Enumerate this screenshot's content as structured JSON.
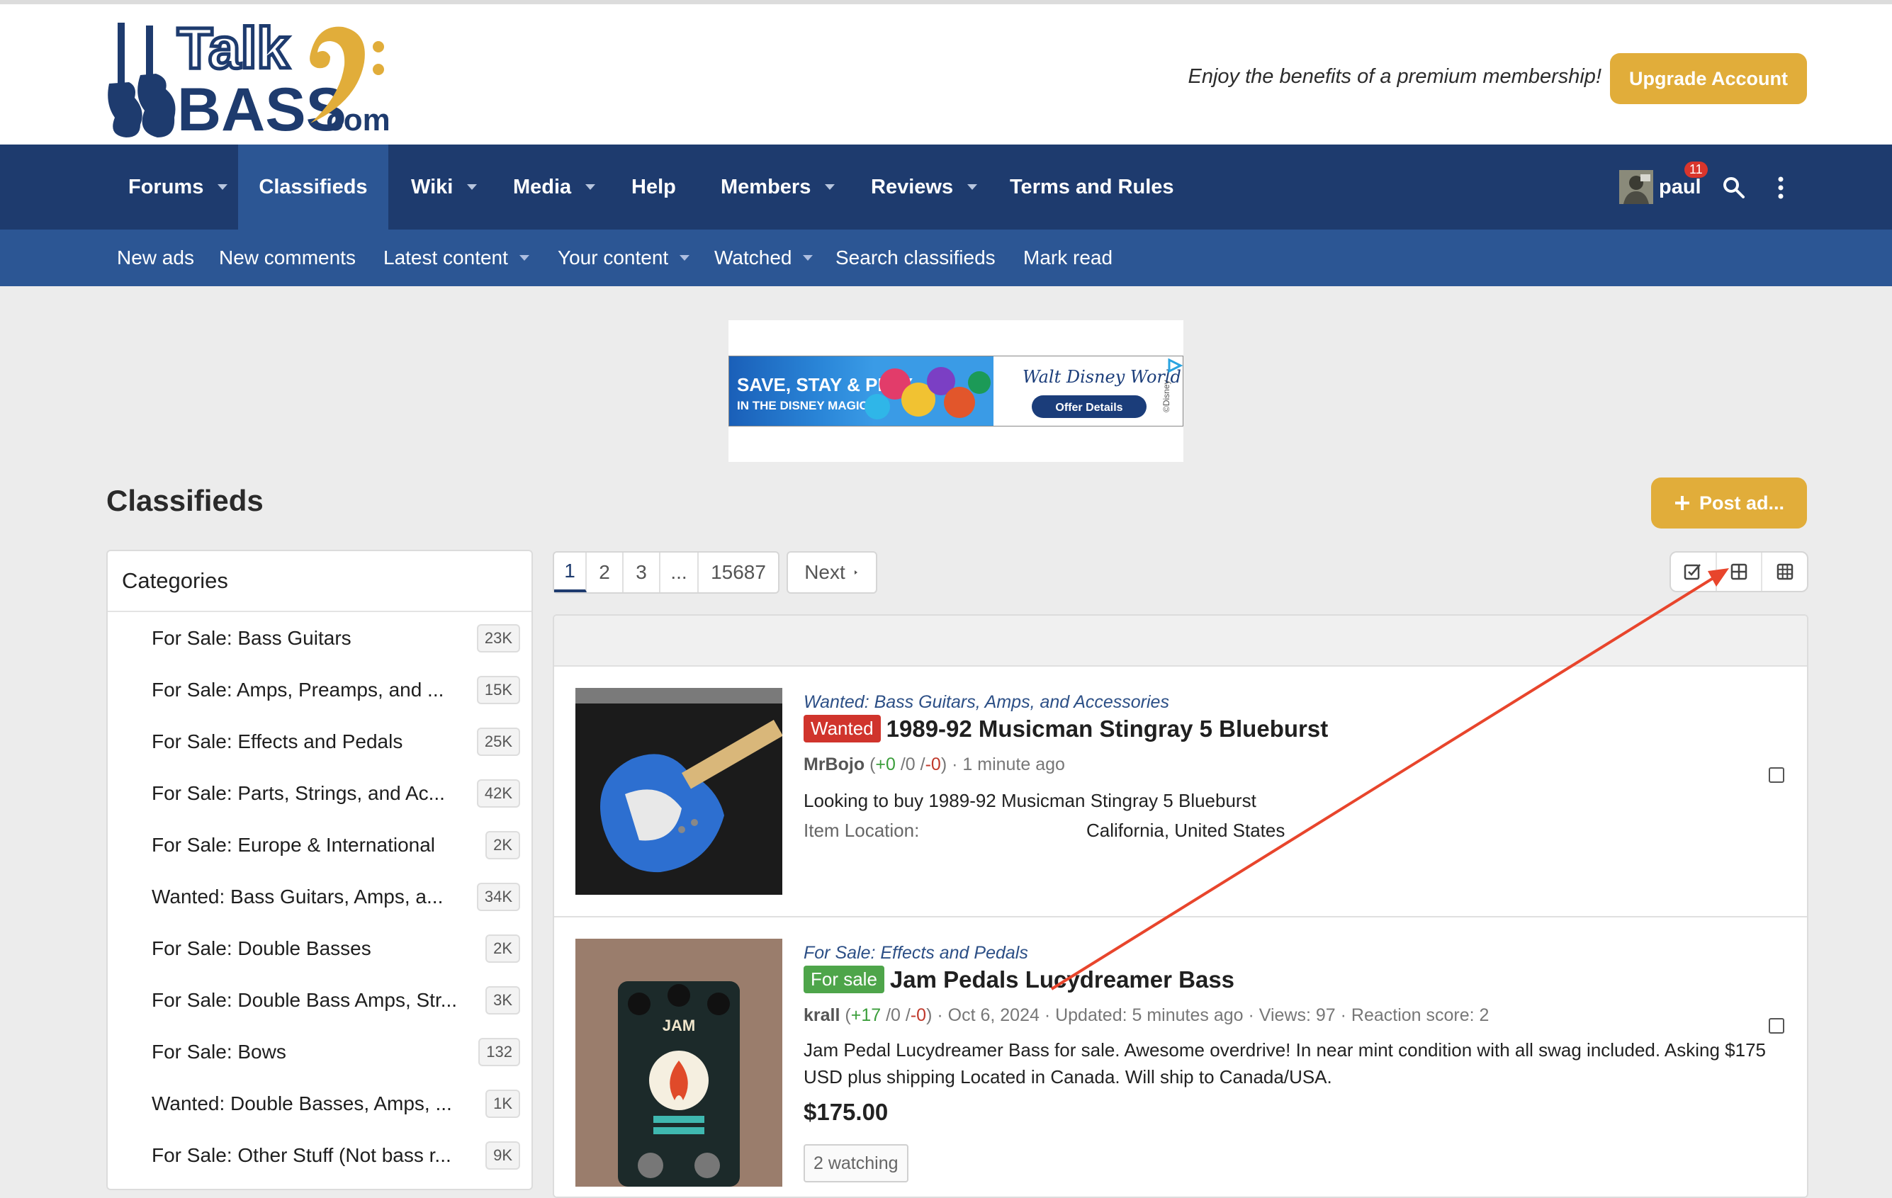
{
  "header": {
    "logo_top": "Talk",
    "logo_bottom": "BASS",
    "logo_suffix": ".com",
    "promo_text": "Enjoy the benefits of a premium membership!",
    "upgrade_label": "Upgrade Account"
  },
  "nav": {
    "items": [
      {
        "label": "Forums"
      },
      {
        "label": "Classifieds"
      },
      {
        "label": "Wiki"
      },
      {
        "label": "Media"
      },
      {
        "label": "Help"
      },
      {
        "label": "Members"
      },
      {
        "label": "Reviews"
      },
      {
        "label": "Terms and Rules"
      }
    ],
    "user_name": "paul",
    "notification_count": "11"
  },
  "subnav": {
    "items": [
      {
        "label": "New ads"
      },
      {
        "label": "New comments"
      },
      {
        "label": "Latest content"
      },
      {
        "label": "Your content"
      },
      {
        "label": "Watched"
      },
      {
        "label": "Search classifieds"
      },
      {
        "label": "Mark read"
      }
    ]
  },
  "ad": {
    "line1": "SAVE, STAY & PLAY",
    "line2": "IN THE DISNEY MAGIC!",
    "brand": "Walt Disney World",
    "cta": "Offer Details",
    "tag": "©Disney"
  },
  "page": {
    "title": "Classifieds",
    "post_ad_label": "Post ad..."
  },
  "categories": {
    "heading": "Categories",
    "items": [
      {
        "label": "For Sale: Bass Guitars",
        "count": "23K"
      },
      {
        "label": "For Sale: Amps, Preamps, and ...",
        "count": "15K"
      },
      {
        "label": "For Sale: Effects and Pedals",
        "count": "25K"
      },
      {
        "label": "For Sale: Parts, Strings, and Ac...",
        "count": "42K"
      },
      {
        "label": "For Sale: Europe & International",
        "count": "2K"
      },
      {
        "label": "Wanted: Bass Guitars, Amps, a...",
        "count": "34K"
      },
      {
        "label": "For Sale: Double Basses",
        "count": "2K"
      },
      {
        "label": "For Sale: Double Bass Amps, Str...",
        "count": "3K"
      },
      {
        "label": "For Sale: Bows",
        "count": "132"
      },
      {
        "label": "Wanted: Double Basses, Amps, ...",
        "count": "1K"
      },
      {
        "label": "For Sale: Other Stuff (Not bass r...",
        "count": "9K"
      }
    ]
  },
  "pagination": {
    "pages": [
      "1",
      "2",
      "3",
      "...",
      "15687"
    ],
    "next_label": "Next"
  },
  "listings": [
    {
      "category": "Wanted: Bass Guitars, Amps, and Accessories",
      "badge": "Wanted",
      "title": "1989-92 Musicman Stingray 5 Blueburst",
      "user": "MrBojo",
      "rating_pos": "+0",
      "rating_neutral": "/0 /",
      "rating_neg": "-0",
      "meta": "· 1 minute ago",
      "description": "Looking to buy 1989-92 Musicman Stingray 5 Blueburst",
      "location_label": "Item Location:",
      "location_value": "California, United States"
    },
    {
      "category": "For Sale: Effects and Pedals",
      "badge": "For sale",
      "title": "Jam Pedals Lucydreamer Bass",
      "user": "krall",
      "rating_pos": "+17",
      "rating_neutral": "/0 /",
      "rating_neg": "-0",
      "meta": "· Oct 6, 2024 · Updated: 5 minutes ago · Views: 97 · Reaction score: 2",
      "description": "Jam Pedal Lucydreamer Bass for sale. Awesome overdrive! In near mint condition with all swag included. Asking $175 USD plus shipping Located in Canada. Will ship to Canada/USA.",
      "price": "$175.00",
      "watching": "2 watching",
      "pedal_logo": "JAM"
    }
  ],
  "colors": {
    "nav": "#1e3b6e",
    "subnav": "#2c5694",
    "accent": "#e1ad3a",
    "wanted": "#d0342c",
    "forsale": "#4ea54a",
    "annotation_arrow": "#e8452c"
  }
}
